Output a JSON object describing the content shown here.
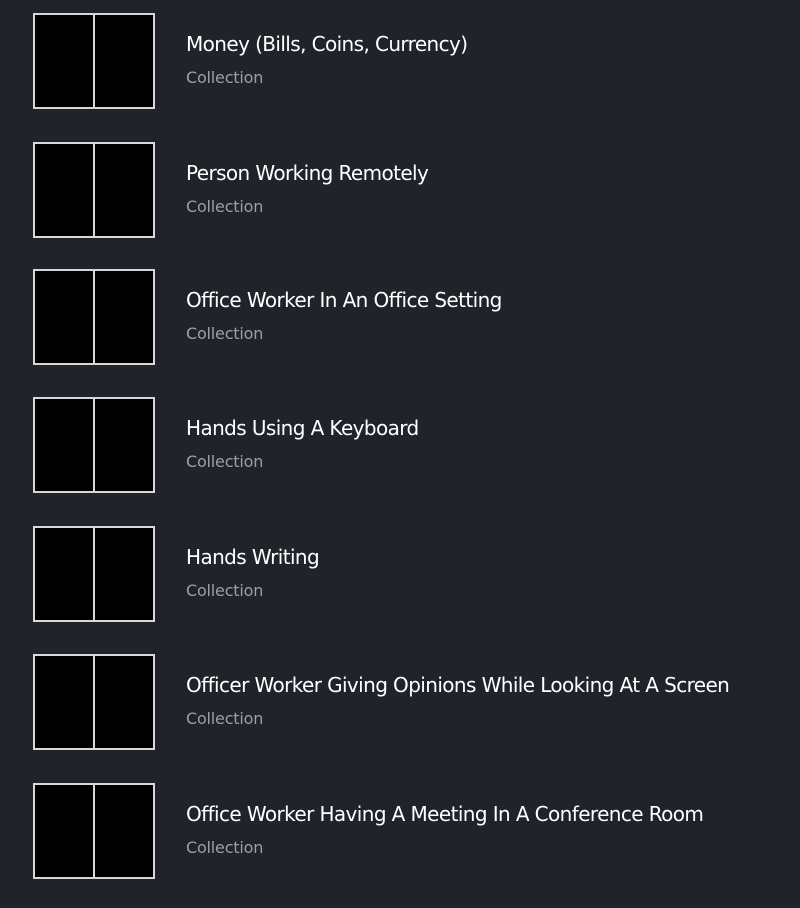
{
  "collections": {
    "items": [
      {
        "title": "Money (Bills, Coins, Currency)",
        "type": "Collection"
      },
      {
        "title": "Person Working Remotely",
        "type": "Collection"
      },
      {
        "title": "Office Worker In An Office Setting",
        "type": "Collection"
      },
      {
        "title": "Hands Using A Keyboard",
        "type": "Collection"
      },
      {
        "title": "Hands Writing",
        "type": "Collection"
      },
      {
        "title": "Officer Worker Giving Opinions While Looking At A Screen",
        "type": "Collection"
      },
      {
        "title": "Office Worker Having A Meeting In A Conference Room",
        "type": "Collection"
      }
    ]
  },
  "colors": {
    "background": "#20232a",
    "thumbnail_fill": "#000000",
    "thumbnail_border": "#d8d8d8",
    "title_text": "#ffffff",
    "subtitle_text": "#9c9fa6"
  }
}
